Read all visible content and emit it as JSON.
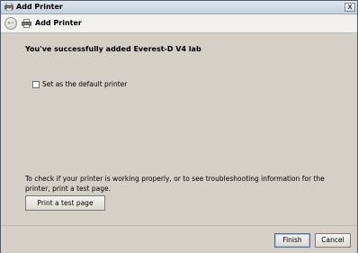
{
  "window": {
    "title": "Add Printer",
    "close_label": "x"
  },
  "header": {
    "title": "Add Printer",
    "back_icon": "back-arrow-icon",
    "printer_icon": "printer-icon"
  },
  "main": {
    "success_message": "You've successfully added Everest-D V4 lab",
    "default_checkbox": {
      "label": "Set as the default printer",
      "checked": false
    },
    "help_text": "To check if your printer is working properly, or to see troubleshooting information for the printer, print a test page.",
    "test_page_button": "Print a test page"
  },
  "footer": {
    "finish_label": "Finish",
    "cancel_label": "Cancel"
  },
  "colors": {
    "face": "#d4d0c8",
    "header_band": "#f2f1ee",
    "title_gradient_top": "#dfe6ef"
  }
}
